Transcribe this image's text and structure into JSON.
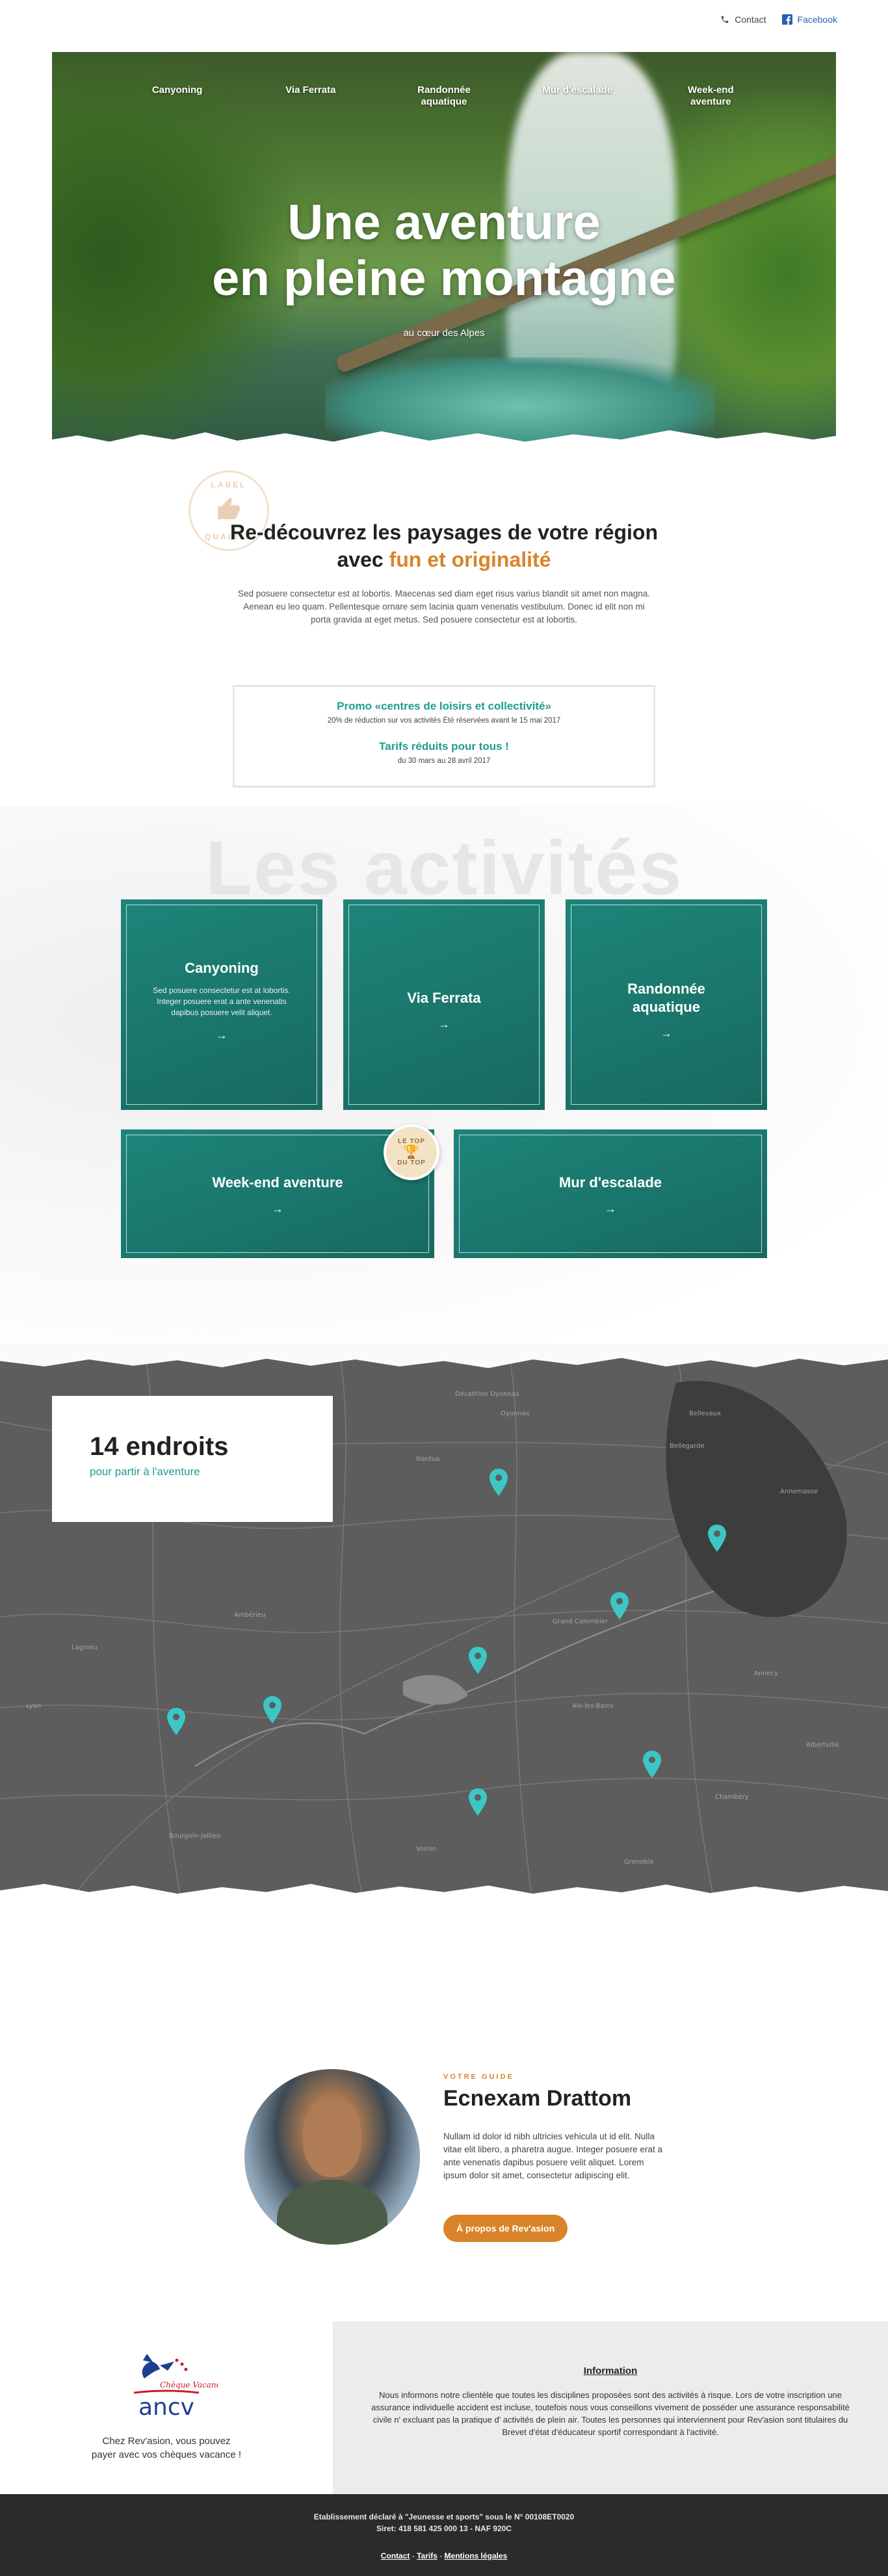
{
  "topbar": {
    "contact_label": "Contact",
    "facebook_label": "Facebook"
  },
  "nav": [
    {
      "label": "Canyoning"
    },
    {
      "label": "Via Ferrata"
    },
    {
      "label": "Randonnée aquatique"
    },
    {
      "label": "Mur d'escalade"
    },
    {
      "label": "Week-end aventure"
    }
  ],
  "hero": {
    "title_line1": "Une aventure",
    "title_line2": "en pleine montagne",
    "subtitle": "au cœur des Alpes"
  },
  "label_badge": {
    "top": "LABEL",
    "bottom": "QUALITÉ"
  },
  "intro": {
    "title_line1": "Re-découvrez les paysages de votre région",
    "title_prefix": "avec",
    "title_accent": "fun et originalité",
    "text": "Sed posuere consectetur est at lobortis. Maecenas sed diam eget risus varius blandit sit amet non magna. Aenean eu leo quam. Pellentesque ornare sem lacinia quam venenatis vestibulum. Donec id elit non mi porta gravida at eget metus. Sed posuere consectetur est at lobortis."
  },
  "promo": {
    "title1": "Promo «centres de loisirs et collectivité»",
    "sub1": "20% de réduction sur vos activités Été réservées avant le 15 mai 2017",
    "title2": "Tarifs réduits pour tous !",
    "sub2": "du 30 mars au 28 avril 2017"
  },
  "activities": {
    "heading": "Les activités",
    "cards": [
      {
        "title": "Canyoning",
        "desc": "Sed posuere consectetur est at lobortis. Integer posuere erat a ante venenatis dapibus posuere velit aliquet.",
        "arrow": "→"
      },
      {
        "title": "Via Ferrata",
        "arrow": "→"
      },
      {
        "title": "Randonnée aquatique",
        "arrow": "→"
      },
      {
        "title": "Week-end aventure",
        "arrow": "→"
      },
      {
        "title": "Mur d'escalade",
        "arrow": "→"
      }
    ],
    "top_badge": {
      "line1": "LE TOP",
      "line2": "DU TOP"
    },
    "card_color": "#1f8c80"
  },
  "map": {
    "title": "14 endroits",
    "subtitle": "pour partir à l'aventure",
    "pin_color": "#3cc6c6",
    "place_labels": [
      "Décathlon Oyonnax",
      "Oyonnax",
      "Bellegarde",
      "Bellevaux",
      "Annemasse",
      "Nantua",
      "Ambérieu",
      "Lagnieu",
      "Grand Colombier",
      "Aix-les-Bains",
      "Chambéry",
      "Lyon",
      "Bourgoin-Jallieu",
      "Grenoble",
      "Voiron",
      "Annecy",
      "Albertville"
    ]
  },
  "guide": {
    "label": "VOTRE GUIDE",
    "name": "Ecnexam Drattom",
    "text": "Nullam id dolor id nibh ultricies vehicula ut id elit. Nulla vitae elit libero, a pharetra augue. Integer posuere erat a ante venenatis dapibus posuere velit aliquet. Lorem ipsum dolor sit amet, consectetur adipiscing elit.",
    "button": "À propos de Rev'asion",
    "accent": "#d9842a"
  },
  "ancv": {
    "logo_label": "Chèque Vacances",
    "logo_text": "ancv",
    "text_line1": "Chez Rev'asion, vous pouvez",
    "text_line2": "payer avec vos chèques vacance !"
  },
  "information": {
    "title": "Information",
    "text": "Nous informons notre clientèle que toutes les disciplines proposées sont des activités à risque. Lors de votre inscription une assurance individuelle accident est incluse, toutefois nous vous conseillons vivement de posséder une assurance responsabilité civile n' excluant pas la pratique d' activités de plein air. Toutes les personnes qui interviennent pour Rev'asion sont titulaires du Brevet d'état d'éducateur sportif correspondant à l'activité."
  },
  "footer": {
    "line1": "Etablissement déclaré à \"Jeunesse et sports\" sous le N° 00108ET0020",
    "line2": "Siret: 418 581 425 000 13 - NAF 920C",
    "links": [
      {
        "label": "Contact"
      },
      {
        "label": "Tarifs"
      },
      {
        "label": "Mentions légales"
      }
    ],
    "separator": " - "
  }
}
